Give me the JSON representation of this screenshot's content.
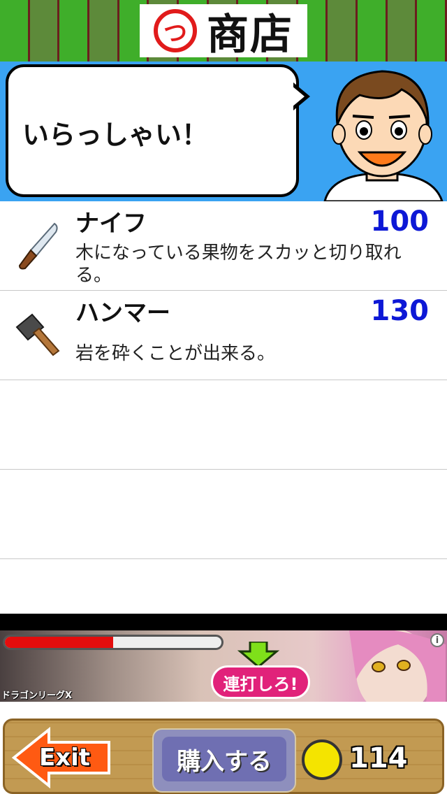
{
  "header": {
    "title": "商店",
    "icon_glyph": "つ",
    "stripe_colors": [
      "#3fae2a",
      "#5d8a3a"
    ]
  },
  "banner": {
    "greeting": "いらっしゃい！",
    "bg_color": "#3aa3f2"
  },
  "shop": {
    "items": [
      {
        "name": "ナイフ",
        "price": "100",
        "description": "木になっている果物をスカッと切り取れる。",
        "icon": "knife-icon"
      },
      {
        "name": "ハンマー",
        "price": "130",
        "description": "岩を砕くことが出来る。",
        "icon": "hammer-icon"
      }
    ],
    "empty_rows": 3
  },
  "ad": {
    "cta": "連打しろ!",
    "game_name": "ドラゴンリーグX",
    "progress": 0.5,
    "info_glyph": "i"
  },
  "footer": {
    "exit_label": "Exit",
    "buy_label": "購入する",
    "coins": "114"
  }
}
